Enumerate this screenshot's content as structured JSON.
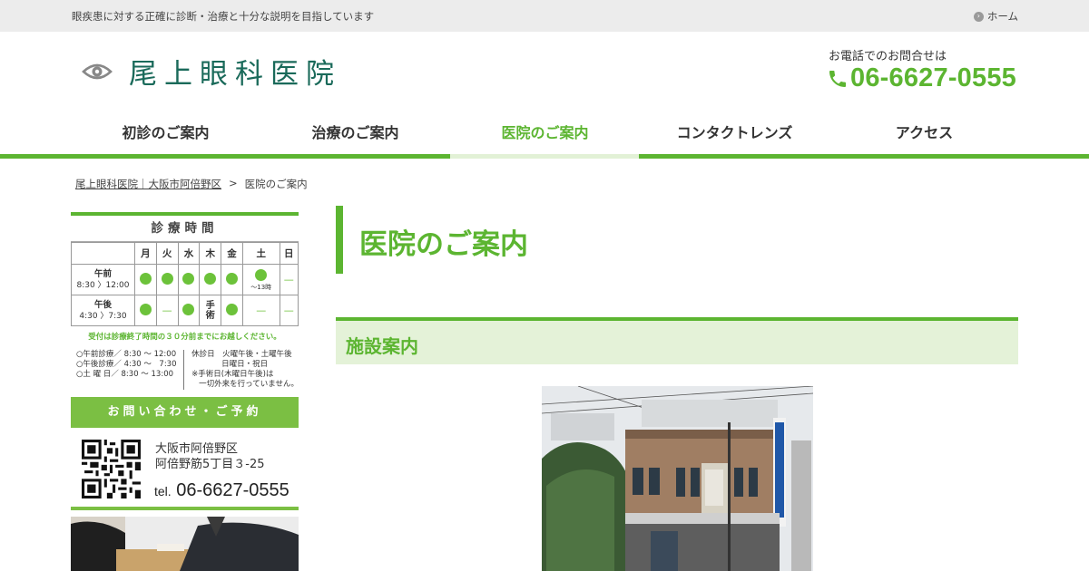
{
  "topbar": {
    "tagline": "眼疾患に対する正確に診断・治療と十分な説明を目指しています",
    "home_label": "ホーム"
  },
  "header": {
    "logo_text": "尾上眼科医院",
    "tel_caption": "お電話でのお問合せは",
    "tel_number": "06-6627-0555"
  },
  "nav": {
    "items": [
      {
        "label": "初診のご案内"
      },
      {
        "label": "治療のご案内"
      },
      {
        "label": "医院のご案内"
      },
      {
        "label": "コンタクトレンズ"
      },
      {
        "label": "アクセス"
      }
    ],
    "active_index": 2
  },
  "breadcrumb": {
    "home": "尾上眼科医院｜大阪市阿倍野区",
    "separator": ">",
    "current": "医院のご案内"
  },
  "hours": {
    "title": "診療時間",
    "days": [
      "月",
      "火",
      "水",
      "木",
      "金",
      "土",
      "日"
    ],
    "am_label": "午前",
    "am_time": "8:30 〉12:00",
    "pm_label": "午後",
    "pm_time": "4:30 〉7:30",
    "sat_note": "〜13時",
    "thu_pm": "手術",
    "notice": "受付は診療終了時間の３０分前までにお越しください。",
    "details": [
      "○午前診療／ 8:30 〜 12:00",
      "○午後診療／ 4:30 〜　7:30",
      "○土 曜 日／ 8:30 〜 13:00"
    ],
    "closed_title": "休診日　火曜午後・土曜午後",
    "closed_2": "日曜日・祝日",
    "closed_note1": "※手術日(木曜日午後)は",
    "closed_note2": "一切外来を行っていません。"
  },
  "contact": {
    "header": "お問い合わせ・ご予約",
    "address1": "大阪市阿倍野区",
    "address2": "阿倍野筋5丁目３-25",
    "tel_prefix": "tel.",
    "tel": "06-6627-0555"
  },
  "main": {
    "page_title": "医院のご案内",
    "section_title": "施設案内"
  },
  "colors": {
    "accent": "#5cb531",
    "logo": "#1a6a5a",
    "section_bg": "#e4f2d8"
  }
}
